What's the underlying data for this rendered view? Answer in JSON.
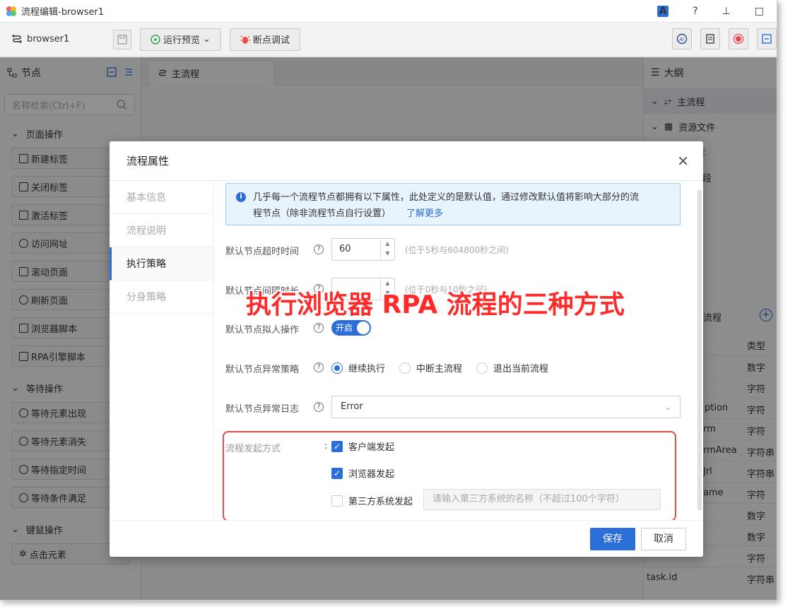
{
  "window": {
    "title": "流程编辑-browser1",
    "controls": {
      "help": "?",
      "pin": "⊥",
      "maximize": "□"
    }
  },
  "toolbar": {
    "flow_name": "browser1",
    "run_preview": "运行预览",
    "breakpoint_debug": "断点调试"
  },
  "left_panel": {
    "title": "节点",
    "search_placeholder": "名称检索(Ctrl+F)",
    "groups": [
      {
        "title": "页面操作",
        "items": [
          "新建标签",
          "关闭标签",
          "激活标签",
          "访问网址",
          "滚动页面",
          "刷新页面",
          "浏览器脚本",
          "RPA引擎脚本"
        ]
      },
      {
        "title": "等待操作",
        "items": [
          "等待元素出现",
          "等待元素消失",
          "等待指定时间",
          "等待条件满足"
        ]
      },
      {
        "title": "键鼠操作",
        "items": [
          "点击元素"
        ]
      }
    ]
  },
  "center": {
    "tab": "主流程"
  },
  "right_panel": {
    "title": "大纲",
    "tree": [
      "主流程",
      "资源文件"
    ],
    "partial": {
      "lib": "库",
      "segment": "片段",
      "flow": "流程",
      "type_header": "类型"
    },
    "vars": [
      {
        "name": "",
        "type": "数字"
      },
      {
        "name": "",
        "type": "字符"
      },
      {
        "name": "ption",
        "type": "字符"
      },
      {
        "name": "rm",
        "type": "字符"
      },
      {
        "name": "rmArea",
        "type": "字符串"
      },
      {
        "name": "Jrl",
        "type": "字符串"
      },
      {
        "name": "ame",
        "type": "字符"
      },
      {
        "name": "",
        "type": "数字"
      },
      {
        "name": "",
        "type": "数字"
      },
      {
        "name": "",
        "type": "字符"
      },
      {
        "name": "task.id",
        "type": "字符串"
      }
    ]
  },
  "dialog": {
    "title": "流程属性",
    "nav": [
      "基本信息",
      "流程说明",
      "执行策略",
      "分身策略"
    ],
    "active_nav": 2,
    "info": {
      "text_line1": "几乎每一个流程节点都拥有以下属性，此处定义的是默认值，通过修改默认值将影响大部分的流",
      "text_line2": "程节点（除非流程节点自行设置）",
      "link": "了解更多"
    },
    "fields": {
      "timeout_label": "默认节点超时时间",
      "timeout_value": "60",
      "timeout_hint": "(位于5秒与604800秒之间)",
      "interval_label": "默认节点间隔时长",
      "interval_hint": "(位于0秒与10秒之间)",
      "humanlike_label": "默认节点拟人操作",
      "humanlike_value": "开启",
      "exception_label": "默认节点异常策略",
      "exception_options": [
        "继续执行",
        "中断主流程",
        "退出当前流程"
      ],
      "exception_selected": 0,
      "log_label": "默认节点异常日志",
      "log_value": "Error",
      "launch_label": "流程发起方式",
      "launch_options": [
        {
          "label": "客户端发起",
          "checked": true
        },
        {
          "label": "浏览器发起",
          "checked": true
        },
        {
          "label": "第三方系统发起",
          "checked": false
        }
      ],
      "third_party_placeholder": "请输入第三方系统的名称（不超过100个字符）"
    },
    "save": "保存",
    "cancel": "取消"
  },
  "caption": "执行浏览器 RPA 流程的三种方式",
  "colors": {
    "accent": "#2b6fd6",
    "highlight": "#e94b4b",
    "caption": "#ff2a2a"
  }
}
